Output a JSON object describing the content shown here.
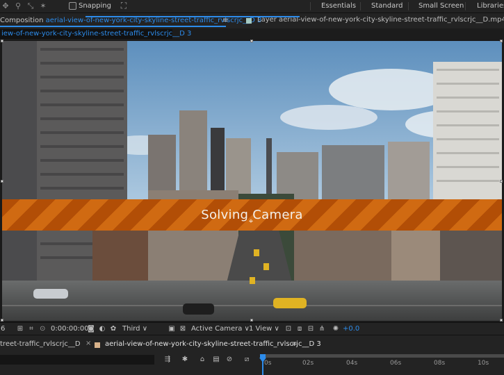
{
  "toolbar": {
    "snapping_label": "Snapping",
    "workspaces": [
      "Essentials",
      "Standard",
      "Small Screen",
      "Libraries"
    ]
  },
  "composition_panel": {
    "tab_prefix": "Composition",
    "tab_name": "aerial-view-of-new-york-city-skyline-street-traffic_rvlscrjc__D 3",
    "breadcrumb": "iew-of-new-york-city-skyline-street-traffic_rvlscrjc__D 3",
    "layer_tab": "Layer aerial-view-of-new-york-city-skyline-street-traffic_rvlscrjc__D.mp4"
  },
  "viewer": {
    "status_text": "Solving Camera"
  },
  "viewer_footer": {
    "zoom_fragment": "6",
    "timecode": "0:00:00:00",
    "resolution": "Third",
    "camera": "Active Camera",
    "views": "1 View",
    "exposure": "+0.0"
  },
  "timeline": {
    "tab1": "treet-traffic_rvlscrjc__D",
    "tab2": "aerial-view-of-new-york-city-skyline-street-traffic_rvlscrjc__D 3",
    "ruler_ticks": [
      "0s",
      "02s",
      "04s",
      "06s",
      "08s",
      "10s"
    ]
  }
}
